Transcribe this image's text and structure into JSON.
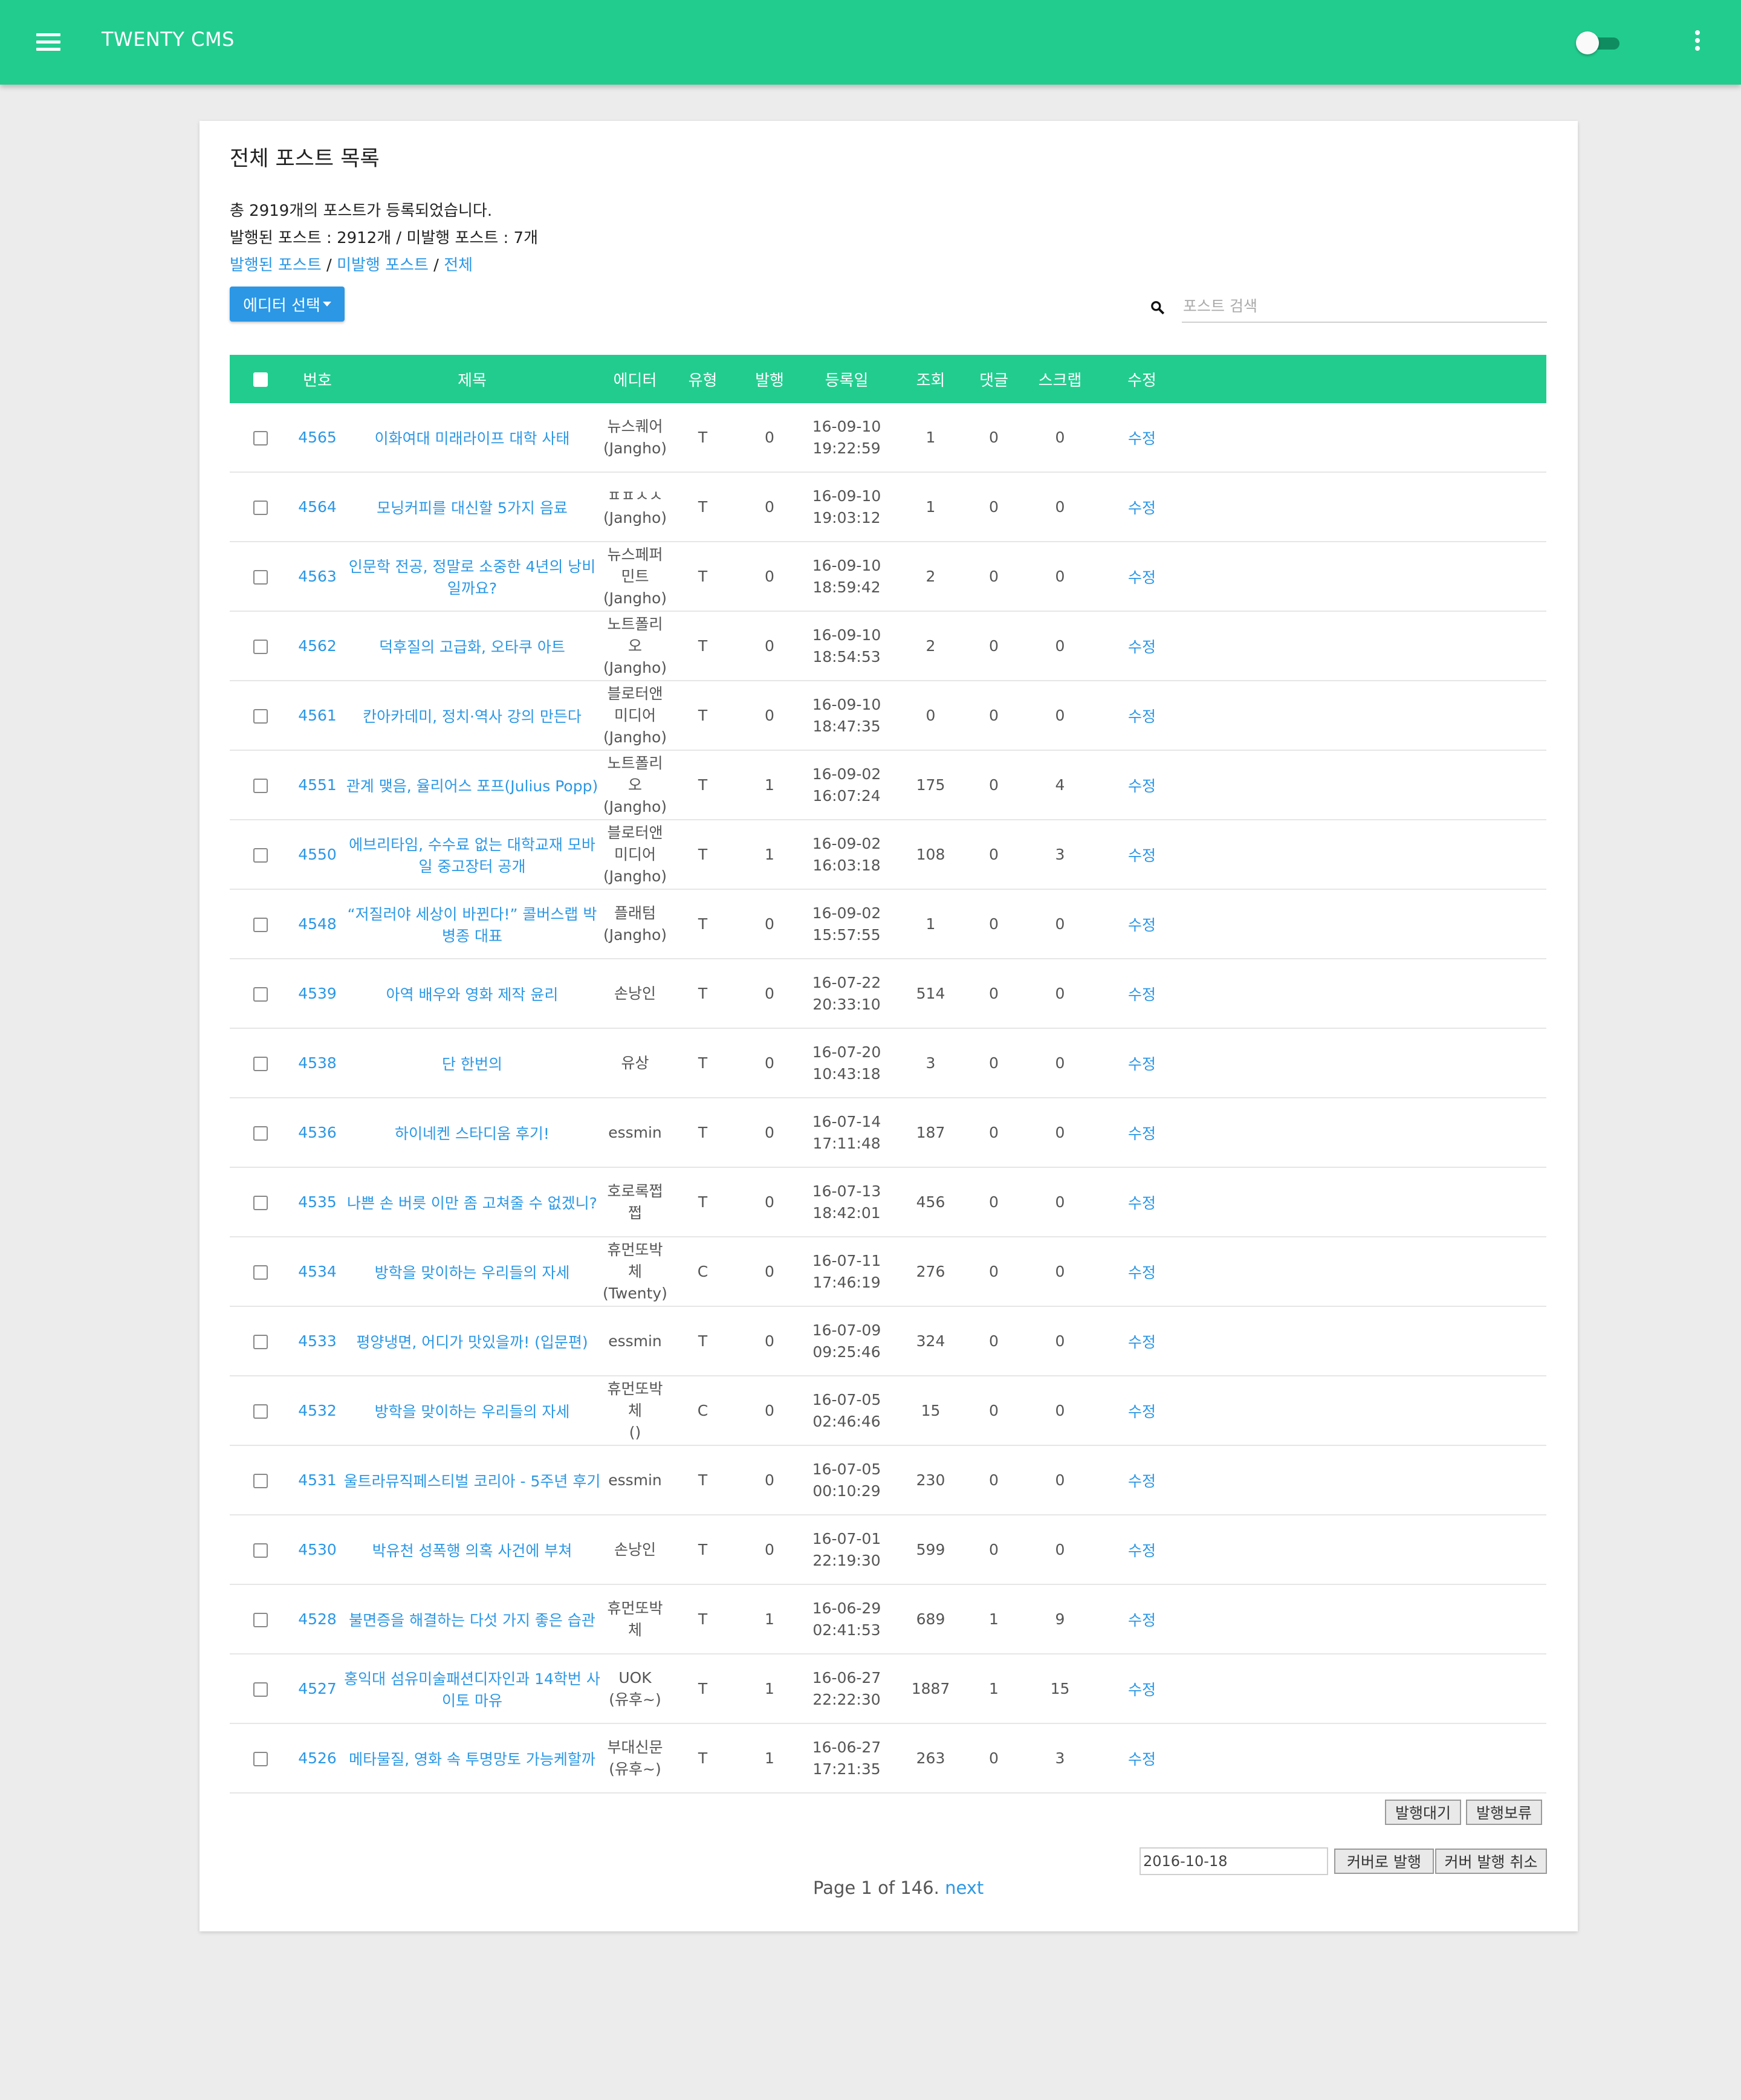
{
  "app": {
    "title": "TWENTY CMS"
  },
  "page": {
    "title": "전체 포스트 목록",
    "summary_total": "총 2919개의 포스트가 등록되었습니다.",
    "summary_counts": "발행된 포스트 : 2912개 / 미발행 포스트 : 7개",
    "filters": {
      "published": "발행된 포스트",
      "unpublished": "미발행 포스트",
      "all": "전체",
      "sep": " / "
    },
    "editor_button": "에디터 선택",
    "search_placeholder": "포스트 검색"
  },
  "table": {
    "headers": [
      "번호",
      "제목",
      "에디터",
      "유형",
      "발행",
      "등록일",
      "조회",
      "댓글",
      "스크랩",
      "수정"
    ],
    "rows": [
      {
        "no": "4565",
        "title": "이화여대 미래라이프 대학 사태",
        "ed1": "뉴스퀘어",
        "ed2": "(Jangho)",
        "type": "T",
        "pub": "0",
        "d1": "16-09-10",
        "d2": "19:22:59",
        "views": "1",
        "comments": "0",
        "scraps": "0",
        "edit": "수정"
      },
      {
        "no": "4564",
        "title": "모닝커피를 대신할 5가지 음료",
        "ed1": "ㅍㅍㅅㅅ",
        "ed2": "(Jangho)",
        "type": "T",
        "pub": "0",
        "d1": "16-09-10",
        "d2": "19:03:12",
        "views": "1",
        "comments": "0",
        "scraps": "0",
        "edit": "수정"
      },
      {
        "no": "4563",
        "title": "인문학 전공, 정말로 소중한 4년의 낭비일까요?",
        "ed1": "뉴스페퍼민트",
        "ed2": "(Jangho)",
        "type": "T",
        "pub": "0",
        "d1": "16-09-10",
        "d2": "18:59:42",
        "views": "2",
        "comments": "0",
        "scraps": "0",
        "edit": "수정"
      },
      {
        "no": "4562",
        "title": "덕후질의 고급화, 오타쿠 아트",
        "ed1": "노트폴리오",
        "ed2": "(Jangho)",
        "type": "T",
        "pub": "0",
        "d1": "16-09-10",
        "d2": "18:54:53",
        "views": "2",
        "comments": "0",
        "scraps": "0",
        "edit": "수정"
      },
      {
        "no": "4561",
        "title": "칸아카데미, 정치·역사 강의 만든다",
        "ed1": "블로터앤미디어",
        "ed2": "(Jangho)",
        "type": "T",
        "pub": "0",
        "d1": "16-09-10",
        "d2": "18:47:35",
        "views": "0",
        "comments": "0",
        "scraps": "0",
        "edit": "수정"
      },
      {
        "no": "4551",
        "title": "관계 맺음, 율리어스 포프(Julius Popp)",
        "ed1": "노트폴리오",
        "ed2": "(Jangho)",
        "type": "T",
        "pub": "1",
        "d1": "16-09-02",
        "d2": "16:07:24",
        "views": "175",
        "comments": "0",
        "scraps": "4",
        "edit": "수정"
      },
      {
        "no": "4550",
        "title": "에브리타임, 수수료 없는 대학교재 모바일 중고장터 공개",
        "ed1": "블로터앤미디어",
        "ed2": "(Jangho)",
        "type": "T",
        "pub": "1",
        "d1": "16-09-02",
        "d2": "16:03:18",
        "views": "108",
        "comments": "0",
        "scraps": "3",
        "edit": "수정"
      },
      {
        "no": "4548",
        "title": "“저질러야 세상이 바뀐다!” 콜버스랩 박병종 대표",
        "ed1": "플래텀",
        "ed2": "(Jangho)",
        "type": "T",
        "pub": "0",
        "d1": "16-09-02",
        "d2": "15:57:55",
        "views": "1",
        "comments": "0",
        "scraps": "0",
        "edit": "수정"
      },
      {
        "no": "4539",
        "title": "아역 배우와 영화 제작 윤리",
        "ed1": "손낭인",
        "ed2": "",
        "type": "T",
        "pub": "0",
        "d1": "16-07-22",
        "d2": "20:33:10",
        "views": "514",
        "comments": "0",
        "scraps": "0",
        "edit": "수정"
      },
      {
        "no": "4538",
        "title": "단 한번의",
        "ed1": "유상",
        "ed2": "",
        "type": "T",
        "pub": "0",
        "d1": "16-07-20",
        "d2": "10:43:18",
        "views": "3",
        "comments": "0",
        "scraps": "0",
        "edit": "수정"
      },
      {
        "no": "4536",
        "title": "하이네켄 스타디움 후기!",
        "ed1": "essmin",
        "ed2": "",
        "type": "T",
        "pub": "0",
        "d1": "16-07-14",
        "d2": "17:11:48",
        "views": "187",
        "comments": "0",
        "scraps": "0",
        "edit": "수정"
      },
      {
        "no": "4535",
        "title": "나쁜 손 버릇 이만 좀 고쳐줄 수 없겠니?",
        "ed1": "호로록쩝쩝",
        "ed2": "",
        "type": "T",
        "pub": "0",
        "d1": "16-07-13",
        "d2": "18:42:01",
        "views": "456",
        "comments": "0",
        "scraps": "0",
        "edit": "수정"
      },
      {
        "no": "4534",
        "title": "방학을 맞이하는 우리들의 자세",
        "ed1": "휴먼또박체",
        "ed2": "(Twenty)",
        "type": "C",
        "pub": "0",
        "d1": "16-07-11",
        "d2": "17:46:19",
        "views": "276",
        "comments": "0",
        "scraps": "0",
        "edit": "수정"
      },
      {
        "no": "4533",
        "title": "평양냉면, 어디가 맛있을까! (입문편)",
        "ed1": "essmin",
        "ed2": "",
        "type": "T",
        "pub": "0",
        "d1": "16-07-09",
        "d2": "09:25:46",
        "views": "324",
        "comments": "0",
        "scraps": "0",
        "edit": "수정"
      },
      {
        "no": "4532",
        "title": "방학을 맞이하는 우리들의 자세",
        "ed1": "휴먼또박체",
        "ed2": "()",
        "type": "C",
        "pub": "0",
        "d1": "16-07-05",
        "d2": "02:46:46",
        "views": "15",
        "comments": "0",
        "scraps": "0",
        "edit": "수정"
      },
      {
        "no": "4531",
        "title": "울트라뮤직페스티벌 코리아 - 5주년 후기",
        "ed1": "essmin",
        "ed2": "",
        "type": "T",
        "pub": "0",
        "d1": "16-07-05",
        "d2": "00:10:29",
        "views": "230",
        "comments": "0",
        "scraps": "0",
        "edit": "수정"
      },
      {
        "no": "4530",
        "title": "박유천 성폭행 의혹 사건에 부쳐",
        "ed1": "손낭인",
        "ed2": "",
        "type": "T",
        "pub": "0",
        "d1": "16-07-01",
        "d2": "22:19:30",
        "views": "599",
        "comments": "0",
        "scraps": "0",
        "edit": "수정"
      },
      {
        "no": "4528",
        "title": "불면증을 해결하는 다섯 가지 좋은 습관",
        "ed1": "휴먼또박체",
        "ed2": "",
        "type": "T",
        "pub": "1",
        "d1": "16-06-29",
        "d2": "02:41:53",
        "views": "689",
        "comments": "1",
        "scraps": "9",
        "edit": "수정"
      },
      {
        "no": "4527",
        "title": "홍익대 섬유미술패션디자인과 14학번 사이토 마유",
        "ed1": "UOK",
        "ed2": "(유후~)",
        "type": "T",
        "pub": "1",
        "d1": "16-06-27",
        "d2": "22:22:30",
        "views": "1887",
        "comments": "1",
        "scraps": "15",
        "edit": "수정"
      },
      {
        "no": "4526",
        "title": "메타물질, 영화 속 투명망토 가능케할까",
        "ed1": "부대신문",
        "ed2": "(유후~)",
        "type": "T",
        "pub": "1",
        "d1": "16-06-27",
        "d2": "17:21:35",
        "views": "263",
        "comments": "0",
        "scraps": "3",
        "edit": "수정"
      }
    ]
  },
  "actions": {
    "wait_button": "발행대기",
    "hold_button": "발행보류",
    "date_value": "2016-10-18",
    "cover_publish_button": "커버로 발행",
    "cover_cancel_button": "커버 발행 취소"
  },
  "pagination": {
    "text": "Page 1 of 146.",
    "next": "next"
  },
  "colors": {
    "primary": "#22cc8f",
    "link": "#2b97e5",
    "background": "#ececec"
  }
}
